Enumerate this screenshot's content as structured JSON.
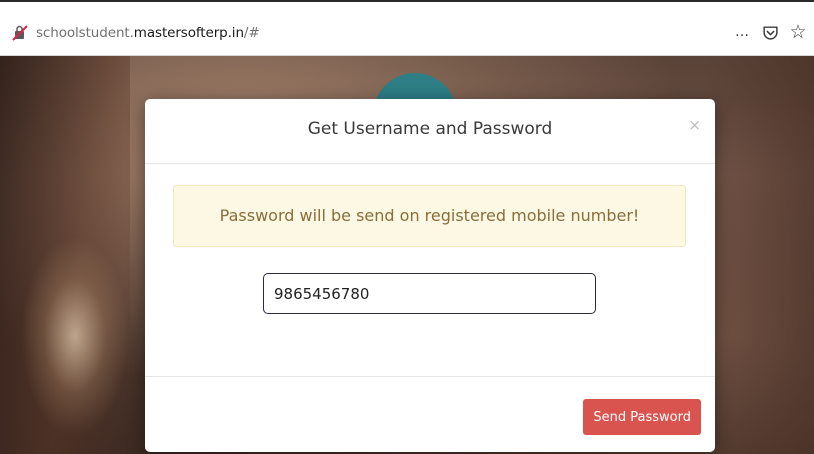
{
  "browser": {
    "url_prefix": "schoolstudent.",
    "url_domain": "mastersofterp.in",
    "url_suffix": "/#",
    "actions": [
      {
        "icon": "more-options-icon",
        "glyph": "…"
      },
      {
        "icon": "pocket-icon",
        "glyph": ""
      },
      {
        "icon": "bookmark-star-icon",
        "glyph": "☆"
      }
    ]
  },
  "modal": {
    "title": "Get Username and Password",
    "close_label": "×",
    "alert_text": "Password will be send on registered mobile number!",
    "mobile_value": "9865456780",
    "send_button_label": "Send Password"
  },
  "colors": {
    "alert_bg": "#fcf8e3",
    "alert_text": "#8a6d3b",
    "button_bg": "#d9534f",
    "teal_accent": "#2d7e86"
  }
}
